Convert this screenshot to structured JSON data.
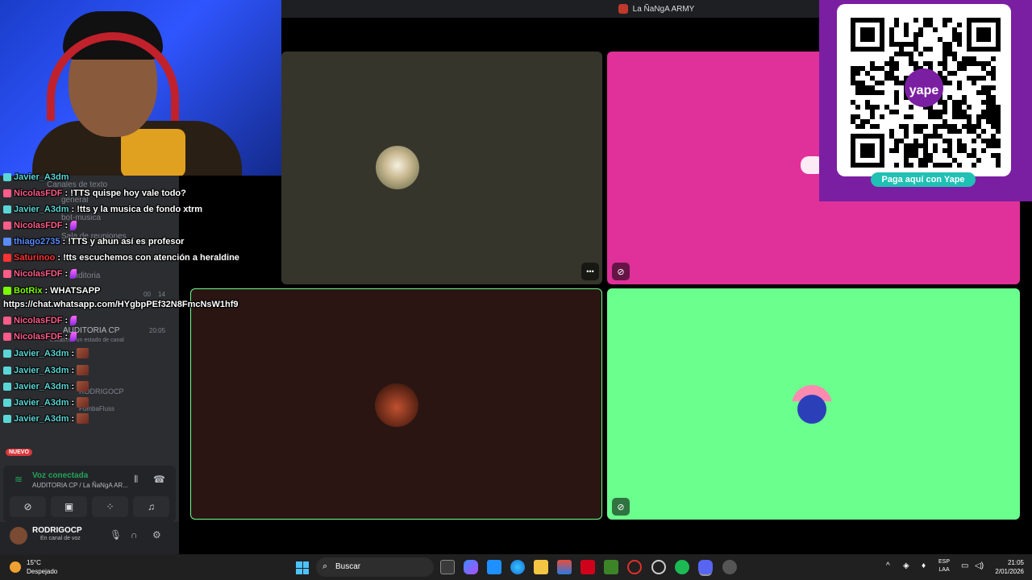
{
  "window": {
    "title": "La ÑaNgA ARMY"
  },
  "sidebar_ghost": {
    "category_text": "Canales de texto",
    "channels": [
      "general",
      "bot-musica"
    ],
    "voice_category": "Sala de reuniones",
    "channel_auditoria": "auditoria",
    "numbers": [
      "00",
      "14"
    ],
    "voice_channel": "AUDITORIA CP",
    "voice_time": "20:05",
    "status_placeholder": "Establece un estado de canal",
    "members": [
      "RODRIGOCP",
      "FumbaFluss"
    ],
    "new_badge": "NUEVO"
  },
  "chat": {
    "messages": [
      {
        "user": "Javier_A3dm",
        "text": "",
        "color": "#5bd6d6"
      },
      {
        "user": "NicolasFDF",
        "text": ": !TTS quispe hoy vale todo?",
        "color": "#ff5c8a"
      },
      {
        "user": "Javier_A3dm",
        "text": ": !tts y la musica de fondo xtrm",
        "color": "#5bd6d6"
      },
      {
        "user": "NicolasFDF",
        "text": ":",
        "color": "#ff5c8a"
      },
      {
        "user": "thiago2735",
        "text": ": !TTS y ahun así es profesor",
        "color": "#5b8cff"
      },
      {
        "user": "Saturinoo",
        "text": ": !tts escuchemos con atención a heraldine",
        "color": "#ff3333"
      },
      {
        "user": "NicolasFDF",
        "text": ":",
        "color": "#ff5c8a"
      },
      {
        "user": "BotRix",
        "text": ": WHATSAPP",
        "color": "#7cfc00"
      },
      {
        "user": "",
        "text": "https://chat.whatsapp.com/HYgbpPEf32N8FmcNsW1hf9",
        "color": "#ffffff"
      },
      {
        "user": "NicolasFDF",
        "text": ":",
        "color": "#ff5c8a"
      },
      {
        "user": "NicolasFDF",
        "text": ":",
        "color": "#ff5c8a"
      },
      {
        "user": "Javier_A3dm",
        "text": ":",
        "color": "#5bd6d6"
      },
      {
        "user": "Javier_A3dm",
        "text": ":",
        "color": "#5bd6d6"
      },
      {
        "user": "Javier_A3dm",
        "text": ":",
        "color": "#5bd6d6"
      },
      {
        "user": "Javier_A3dm",
        "text": ":",
        "color": "#5bd6d6"
      },
      {
        "user": "Javier_A3dm",
        "text": ":",
        "color": "#5bd6d6"
      }
    ]
  },
  "qr": {
    "button_label": "Paga aquí con Yape",
    "logo_text": "yape"
  },
  "voice": {
    "status": "Voz conectada",
    "channel": "AUDITORIA CP / La ÑaNgA AR...",
    "username": "RODRIGOCP",
    "user_status": "En canal de voz"
  },
  "taskbar": {
    "temperature": "15°C",
    "condition": "Despejado",
    "search_placeholder": "Buscar",
    "lang_1": "ESP",
    "lang_2": "LAA",
    "time": "21:05",
    "date": "2/01/2026"
  },
  "colors": {
    "tile1": "#36352b",
    "tile2": "#e0309a",
    "tile3": "#2a1512",
    "tile4": "#6bff8e",
    "qr_bg": "#7b1fa2",
    "accent_green": "#23a559"
  }
}
